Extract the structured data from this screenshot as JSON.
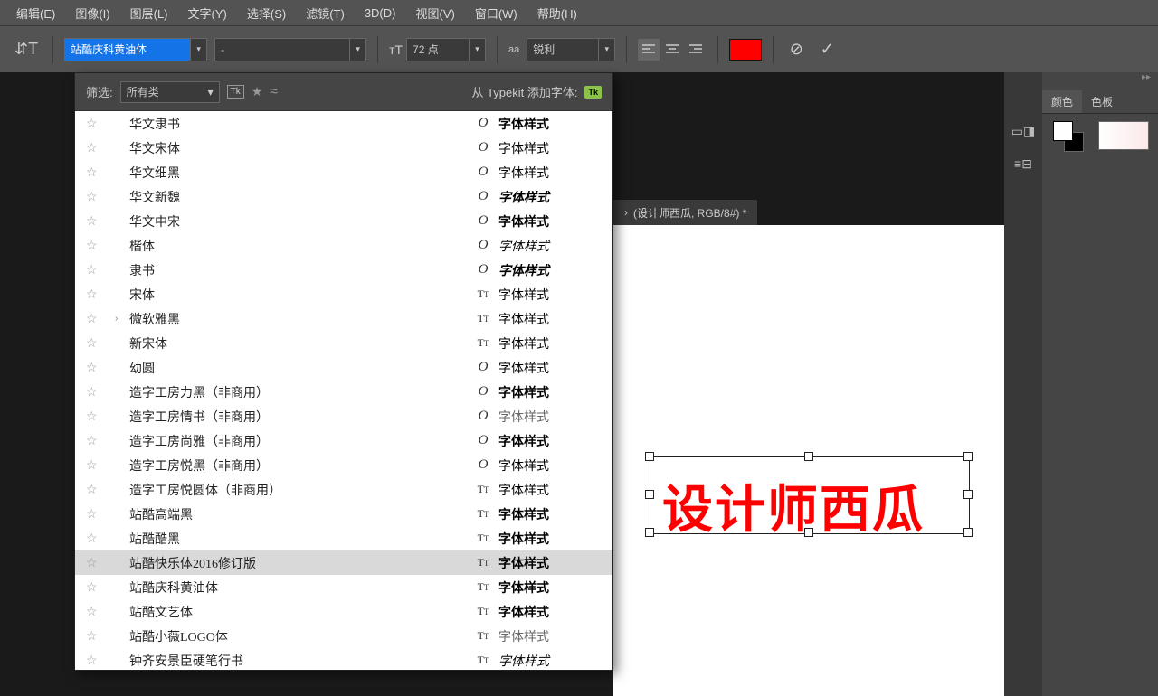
{
  "menu": [
    "编辑(E)",
    "图像(I)",
    "图层(L)",
    "文字(Y)",
    "选择(S)",
    "滤镜(T)",
    "3D(D)",
    "视图(V)",
    "窗口(W)",
    "帮助(H)"
  ],
  "options": {
    "font_family": "站酷庆科黄油体",
    "font_style": "-",
    "font_size": "72 点",
    "aa_label": "aa",
    "aa_mode": "锐利",
    "text_color": "#ff0000"
  },
  "font_panel": {
    "filter_label": "筛选:",
    "filter_value": "所有类",
    "tk_label": "从 Typekit 添加字体:",
    "tk_badge": "Tk"
  },
  "fonts": [
    {
      "name": "华文隶书",
      "type": "O",
      "sample": "字体样式",
      "bold": true
    },
    {
      "name": "华文宋体",
      "type": "O",
      "sample": "字体样式"
    },
    {
      "name": "华文细黑",
      "type": "O",
      "sample": "字体样式"
    },
    {
      "name": "华文新魏",
      "type": "O",
      "sample": "字体样式",
      "italic": true,
      "bold": true
    },
    {
      "name": "华文中宋",
      "type": "O",
      "sample": "字体样式",
      "bold": true
    },
    {
      "name": "楷体",
      "type": "O",
      "sample": "字体样式",
      "italic": true
    },
    {
      "name": "隶书",
      "type": "O",
      "sample": "字体样式",
      "boldItalic": true
    },
    {
      "name": "宋体",
      "type": "Tr",
      "sample": "字体样式"
    },
    {
      "name": "微软雅黑",
      "type": "Tr",
      "sample": "字体样式",
      "expand": true
    },
    {
      "name": "新宋体",
      "type": "Tr",
      "sample": "字体样式"
    },
    {
      "name": "幼圆",
      "type": "O",
      "sample": "字体样式"
    },
    {
      "name": "造字工房力黑（非商用）",
      "type": "O",
      "sample": "字体样式",
      "bold": true
    },
    {
      "name": "造字工房情书（非商用）",
      "type": "O",
      "sample": "字体样式",
      "light": true
    },
    {
      "name": "造字工房尚雅（非商用）",
      "type": "O",
      "sample": "字体样式",
      "bold": true
    },
    {
      "name": "造字工房悦黑（非商用）",
      "type": "O",
      "sample": "字体样式"
    },
    {
      "name": "造字工房悦圆体（非商用）",
      "type": "Tr",
      "sample": "字体样式"
    },
    {
      "name": "站酷高端黑",
      "type": "Tr",
      "sample": "字体样式",
      "bold": true
    },
    {
      "name": "站酷酷黑",
      "type": "Tr",
      "sample": "字体样式",
      "bold": true
    },
    {
      "name": "站酷快乐体2016修订版",
      "type": "Tr",
      "sample": "字体样式",
      "bold": true,
      "highlighted": true
    },
    {
      "name": "站酷庆科黄油体",
      "type": "Tr",
      "sample": "字体样式",
      "bold": true
    },
    {
      "name": "站酷文艺体",
      "type": "Tr",
      "sample": "字体样式",
      "bold": true
    },
    {
      "name": "站酷小薇LOGO体",
      "type": "Tr",
      "sample": "字体样式",
      "light": true
    },
    {
      "name": "钟齐安景臣硬笔行书",
      "type": "Tr",
      "sample": "字体样式",
      "script": true
    }
  ],
  "document": {
    "tab_label": "(设计师西瓜, RGB/8#) *",
    "canvas_text": "设计师西瓜"
  },
  "panels": {
    "tabs": [
      "颜色",
      "色板"
    ]
  }
}
